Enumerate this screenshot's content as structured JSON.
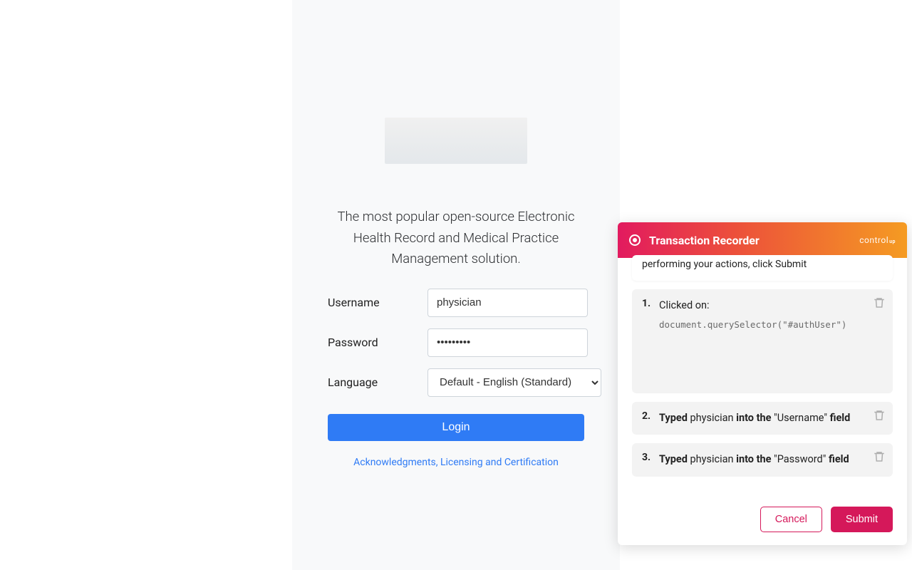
{
  "login": {
    "tagline": "The most popular open-source Electronic Health Record and Medical Practice Management solution.",
    "username_label": "Username",
    "username_value": "physician",
    "password_label": "Password",
    "password_value": "physician",
    "language_label": "Language",
    "language_value": "Default - English (Standard)",
    "login_button": "Login",
    "ack_link": "Acknowledgments, Licensing and Certification"
  },
  "recorder": {
    "title": "Transaction Recorder",
    "brand": "control",
    "brand_sup": "up",
    "info": "Recording in progress. When you are finished performing your actions, click Submit",
    "info_visible_tail": "performing your actions, click Submit",
    "steps": [
      {
        "num": "1.",
        "label": "Clicked on:",
        "code": "document.querySelector(\"#authUser\")"
      },
      {
        "num": "2.",
        "pre": "Typed ",
        "val": "physician",
        "mid": " into the ",
        "field": "\"Username\"",
        "post": " field"
      },
      {
        "num": "3.",
        "pre": "Typed ",
        "val": "physician",
        "mid": " into the ",
        "field": "\"Password\"",
        "post": " field"
      }
    ],
    "cancel": "Cancel",
    "submit": "Submit"
  }
}
